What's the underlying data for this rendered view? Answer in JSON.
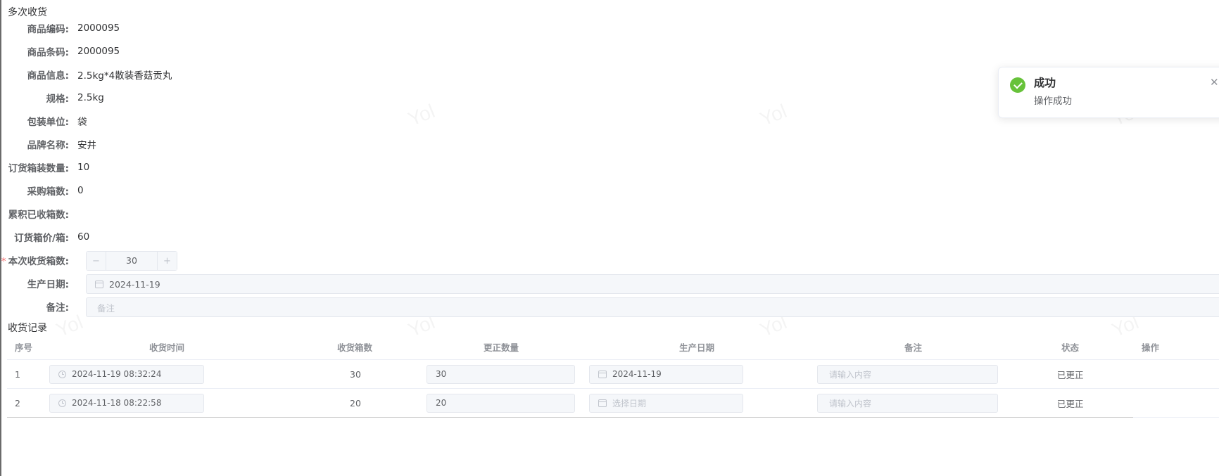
{
  "page": {
    "title": "多次收货"
  },
  "form": {
    "fields": [
      {
        "label": "商品编码:",
        "value": "2000095"
      },
      {
        "label": "商品条码:",
        "value": "2000095"
      },
      {
        "label": "商品信息:",
        "value": "2.5kg*4散装香菇贡丸"
      },
      {
        "label": "规格:",
        "value": "2.5kg"
      },
      {
        "label": "包装单位:",
        "value": "袋"
      },
      {
        "label": "品牌名称:",
        "value": "安井"
      },
      {
        "label": "订货箱装数量:",
        "value": "10"
      },
      {
        "label": "采购箱数:",
        "value": "0"
      },
      {
        "label": "累积已收箱数:",
        "value": ""
      },
      {
        "label": "订货箱价/箱:",
        "value": "60"
      }
    ],
    "receive_qty": {
      "label": "本次收货箱数:",
      "required_mark": "*",
      "value": "30",
      "minus": "−",
      "plus": "+"
    },
    "production_date": {
      "label": "生产日期:",
      "value": "2024-11-19"
    },
    "remark": {
      "label": "备注:",
      "placeholder": "备注"
    }
  },
  "records": {
    "title": "收货记录",
    "columns": [
      "序号",
      "收货时间",
      "收货箱数",
      "更正数量",
      "生产日期",
      "备注",
      "状态",
      "操作"
    ],
    "rows": [
      {
        "index": "1",
        "time": "2024-11-19 08:32:24",
        "boxes": "30",
        "corrected": "30",
        "date": "2024-11-19",
        "date_placeholder": "",
        "remark_placeholder": "请输入内容",
        "status": "已更正"
      },
      {
        "index": "2",
        "time": "2024-11-18 08:22:58",
        "boxes": "20",
        "corrected": "20",
        "date": "",
        "date_placeholder": "选择日期",
        "remark_placeholder": "请输入内容",
        "status": "已更正"
      }
    ]
  },
  "toast": {
    "title": "成功",
    "message": "操作成功",
    "close": "✕"
  },
  "watermark": "Yol",
  "colors": {
    "success": "#67c23a",
    "required": "#f56c6c"
  }
}
